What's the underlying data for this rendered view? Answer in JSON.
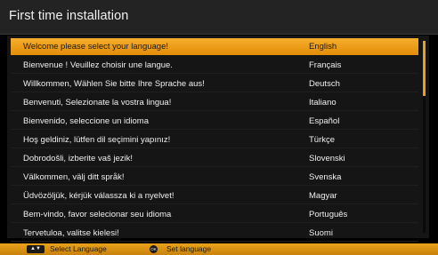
{
  "title": "First time installation",
  "accent_color": "#f0a21f",
  "languages": [
    {
      "message": "Welcome please select your language!",
      "language": "English",
      "selected": true
    },
    {
      "message": "Bienvenue ! Veuillez choisir une langue.",
      "language": "Français",
      "selected": false
    },
    {
      "message": "Willkommen, Wählen Sie bitte Ihre Sprache aus!",
      "language": "Deutsch",
      "selected": false
    },
    {
      "message": "Benvenuti, Selezionate la vostra lingua!",
      "language": "Italiano",
      "selected": false
    },
    {
      "message": "Bienvenido, seleccione un idioma",
      "language": "Español",
      "selected": false
    },
    {
      "message": "Hoş geldiniz, lütfen dil seçimini yapınız!",
      "language": "Türkçe",
      "selected": false
    },
    {
      "message": "Dobrodošli, izberite vaš jezik!",
      "language": "Slovenski",
      "selected": false
    },
    {
      "message": "Välkommen, välj ditt språk!",
      "language": "Svenska",
      "selected": false
    },
    {
      "message": "Üdvözöljük, kérjük válassza ki a nyelvet!",
      "language": "Magyar",
      "selected": false
    },
    {
      "message": "Bem-vindo, favor selecionar seu idioma",
      "language": "Português",
      "selected": false
    },
    {
      "message": "Tervetuloa, valitse kielesi!",
      "language": "Suomi",
      "selected": false
    }
  ],
  "footer": {
    "key_icon": "up-down-arrow-icon",
    "key_symbol": "▲▼",
    "select_hint": "Select Language",
    "ok_icon": "ok-button-icon",
    "ok_symbol": "OK",
    "set_hint": "Set language"
  }
}
